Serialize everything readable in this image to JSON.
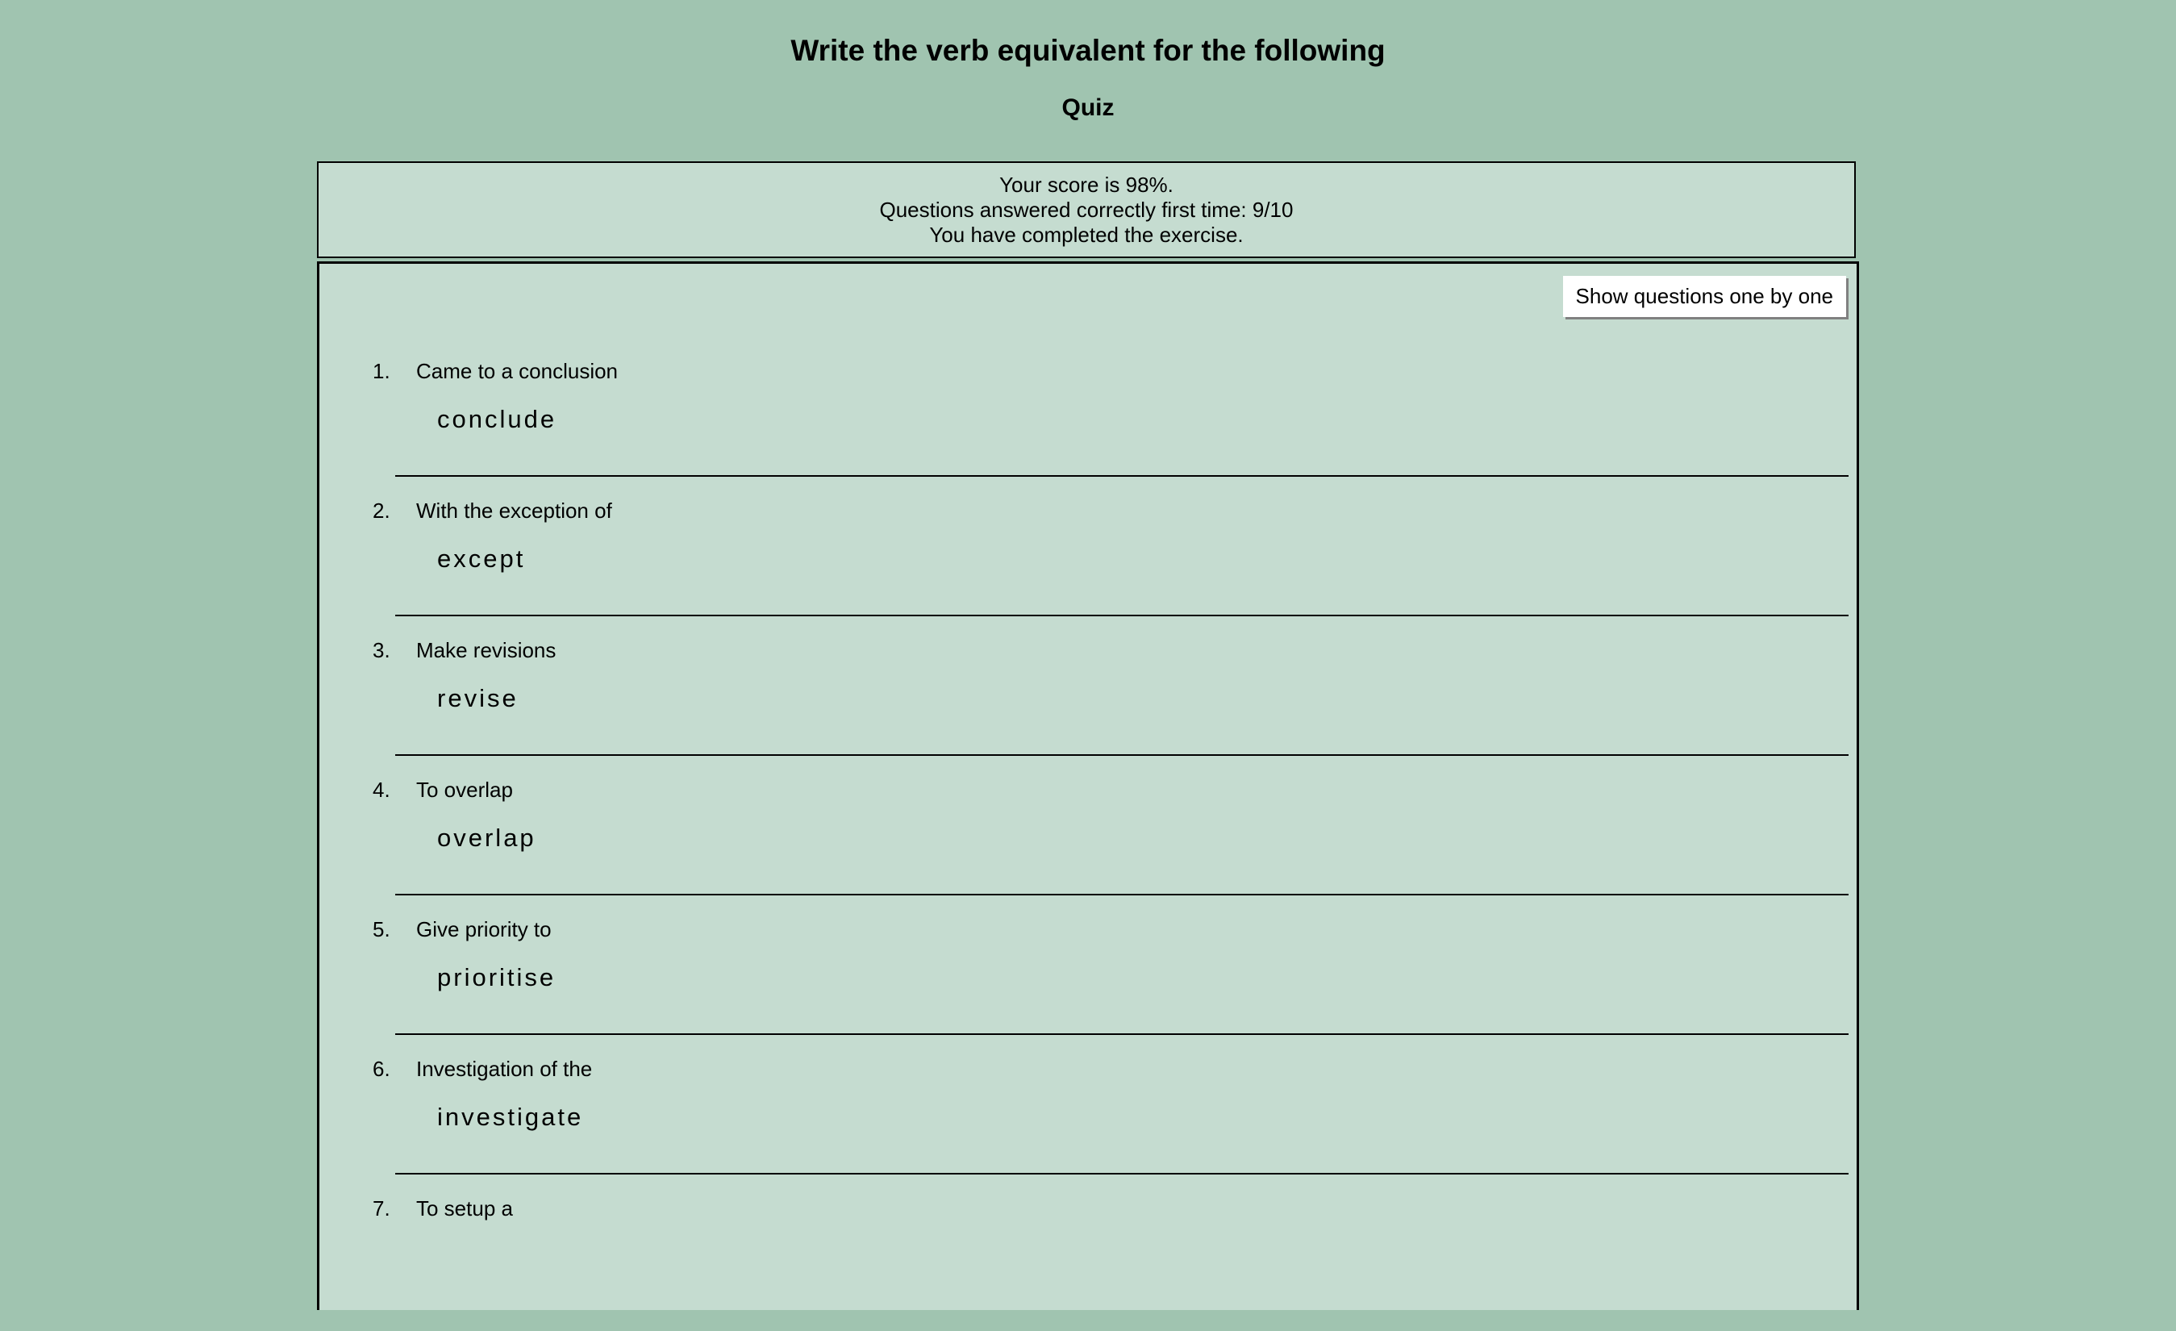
{
  "header": {
    "title": "Write the verb equivalent for the following",
    "subtitle": "Quiz"
  },
  "score": {
    "line1": "Your score is 98%.",
    "line2": "Questions answered correctly first time: 9/10",
    "line3": "You have completed the exercise."
  },
  "toolbar": {
    "show_one_by_one": "Show questions one by one"
  },
  "questions": [
    {
      "num": "1.",
      "text": "Came to a conclusion",
      "answer": "conclude"
    },
    {
      "num": "2.",
      "text": "With the exception of",
      "answer": "except"
    },
    {
      "num": "3.",
      "text": "Make revisions",
      "answer": "revise"
    },
    {
      "num": "4.",
      "text": "To overlap",
      "answer": "overlap"
    },
    {
      "num": "5.",
      "text": "Give priority to",
      "answer": "prioritise"
    },
    {
      "num": "6.",
      "text": "Investigation of the",
      "answer": "investigate"
    },
    {
      "num": "7.",
      "text": "To setup a",
      "answer": ""
    }
  ]
}
